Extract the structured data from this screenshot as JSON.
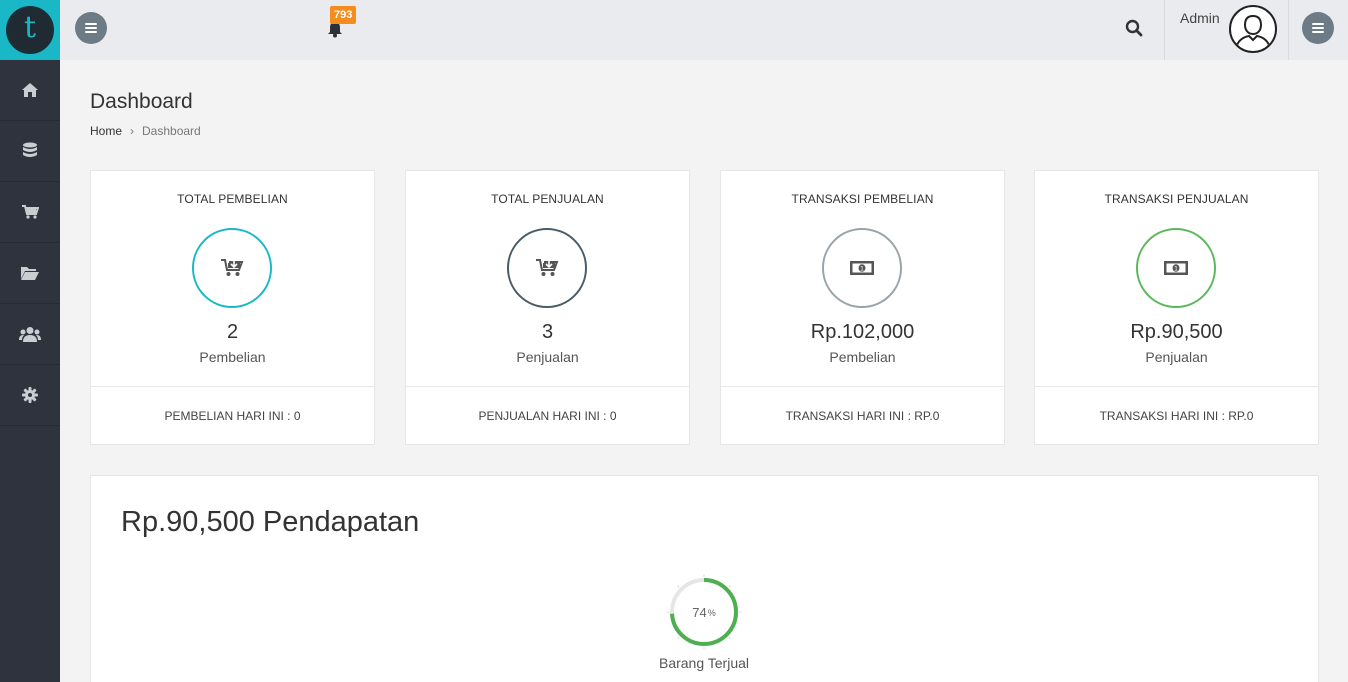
{
  "sidebar": {
    "logo_letter": "t",
    "items": [
      {
        "icon": "home-icon"
      },
      {
        "icon": "database-icon"
      },
      {
        "icon": "cart-icon"
      },
      {
        "icon": "folder-open-icon"
      },
      {
        "icon": "users-icon"
      },
      {
        "icon": "gear-icon"
      }
    ]
  },
  "header": {
    "notification_count": "793",
    "user_name": "Admin"
  },
  "page": {
    "title": "Dashboard",
    "breadcrumb": {
      "home": "Home",
      "separator": "›",
      "current": "Dashboard"
    }
  },
  "cards": [
    {
      "title": "TOTAL PEMBELIAN",
      "icon": "cart-download-icon",
      "color": "#1ab8c6",
      "value": "2",
      "sub": "Pembelian",
      "footer": "PEMBELIAN HARI INI : 0"
    },
    {
      "title": "TOTAL PENJUALAN",
      "icon": "cart-download-icon",
      "color": "#4a5c66",
      "value": "3",
      "sub": "Penjualan",
      "footer": "PENJUALAN HARI INI : 0"
    },
    {
      "title": "TRANSAKSI PEMBELIAN",
      "icon": "money-icon",
      "color": "#9aa3a8",
      "value": "Rp.102,000",
      "sub": "Pembelian",
      "footer": "TRANSAKSI HARI INI : RP.0"
    },
    {
      "title": "TRANSAKSI PENJUALAN",
      "icon": "money-icon",
      "color": "#5cb85c",
      "value": "Rp.90,500",
      "sub": "Penjualan",
      "footer": "TRANSAKSI HARI INI : RP.0"
    }
  ],
  "revenue": {
    "title": "Rp.90,500 Pendapatan",
    "gauge_value": "74",
    "gauge_unit": "%",
    "gauge_percent": 74,
    "gauge_color": "#4caf50",
    "gauge_label": "Barang Terjual"
  }
}
